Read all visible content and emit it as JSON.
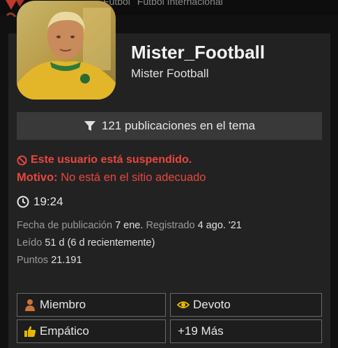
{
  "topbar": {
    "crumbs": [
      "Fútbol",
      "Fútbol Internacional"
    ]
  },
  "user": {
    "username": "Mister_Football",
    "full_name": "Mister Football"
  },
  "filter": {
    "label": "121 publicaciones en el tema",
    "icon": "filter-icon"
  },
  "suspension": {
    "message": "Este usuario está suspendido.",
    "reason_label": "Motivo:",
    "reason_value": "No está en el sitio adecuado",
    "color": "#e8473f"
  },
  "local_time": "19:24",
  "stats": {
    "posted_label": "Fecha de publicación",
    "posted_value": "7 ene.",
    "registered_label": "Registrado",
    "registered_value": "4 ago. '21",
    "read_label": "Leído",
    "read_value": "51 d (6 d recientemente)",
    "points_label": "Puntos",
    "points_value": "21.191"
  },
  "badges": [
    {
      "label": "Miembro",
      "icon": "person-icon",
      "color": "#c8733a"
    },
    {
      "label": "Devoto",
      "icon": "eye-icon",
      "color": "#e6b800"
    },
    {
      "label": "Empático",
      "icon": "thumbs-up-icon",
      "color": "#e6b800"
    },
    {
      "label": "+19 Más"
    }
  ]
}
